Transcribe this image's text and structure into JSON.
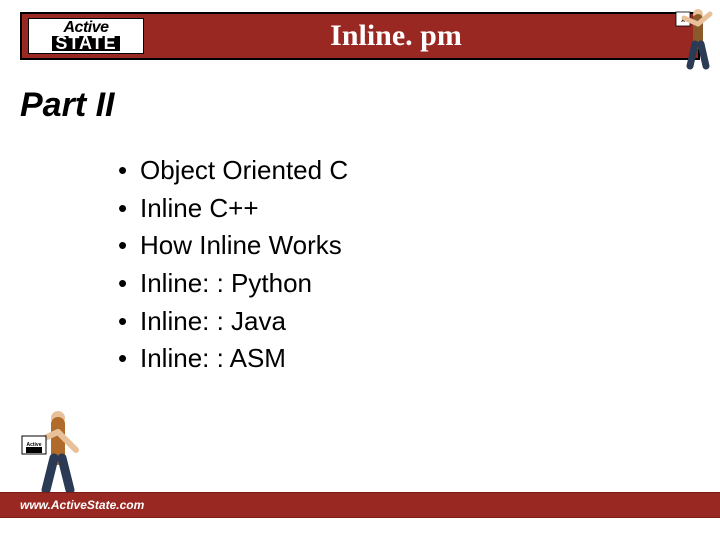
{
  "header": {
    "logo_top": "Active",
    "logo_bottom": "STATE",
    "title": "Inline. pm"
  },
  "section_title": "Part II",
  "bullets": [
    "Object Oriented C",
    "Inline C++",
    "How Inline Works",
    "Inline: : Python",
    "Inline: : Java",
    "Inline: : ASM"
  ],
  "footer": {
    "url": "www.ActiveState.com"
  }
}
